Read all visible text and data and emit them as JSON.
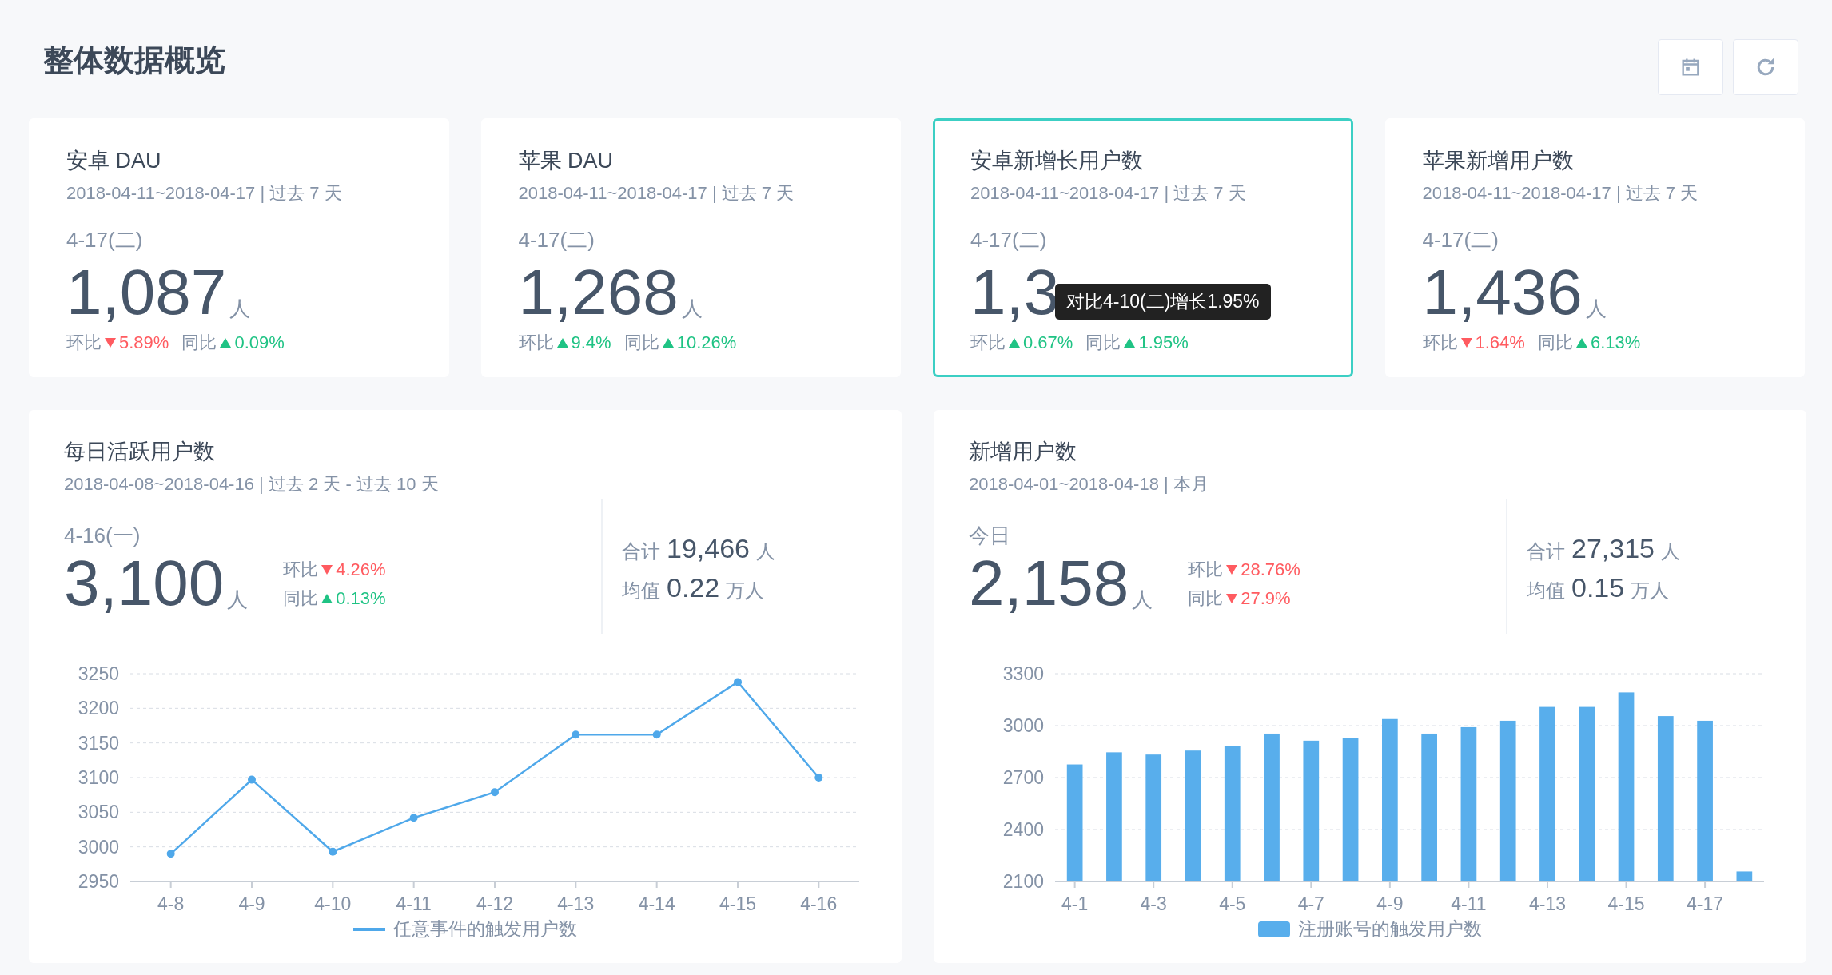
{
  "page": {
    "title": "整体数据概览"
  },
  "toolbar": [
    {
      "kind": "calendar"
    },
    {
      "kind": "refresh"
    }
  ],
  "summary_cards": [
    {
      "title": "安卓 DAU",
      "range": "2018-04-11~2018-04-17 | 过去 7 天",
      "date": "4-17(二)",
      "value": "1,087",
      "unit": "人",
      "selected": false,
      "compare": [
        {
          "label": "环比",
          "up": false,
          "change": "5.89%"
        },
        {
          "label": "同比",
          "up": true,
          "change": "0.09%"
        }
      ]
    },
    {
      "title": "苹果 DAU",
      "range": "2018-04-11~2018-04-17 | 过去 7 天",
      "date": "4-17(二)",
      "value": "1,268",
      "unit": "人",
      "selected": false,
      "compare": [
        {
          "label": "环比",
          "up": true,
          "change": "9.4%"
        },
        {
          "label": "同比",
          "up": true,
          "change": "10.26%"
        }
      ]
    },
    {
      "title": "安卓新增长用户数",
      "range": "2018-04-11~2018-04-17 | 过去 7 天",
      "date": "4-17(二)",
      "value": "1,3",
      "selected": true,
      "tooltip": "对比4-10(二)增长1.95%",
      "compare": [
        {
          "label": "环比",
          "up": true,
          "change": "0.67%"
        },
        {
          "label": "同比",
          "up": true,
          "change": "1.95%"
        }
      ]
    },
    {
      "title": "苹果新增用户数",
      "range": "2018-04-11~2018-04-17 | 过去 7 天",
      "date": "4-17(二)",
      "value": "1,436",
      "unit": "人",
      "selected": false,
      "compare": [
        {
          "label": "环比",
          "up": false,
          "change": "1.64%"
        },
        {
          "label": "同比",
          "up": true,
          "change": "6.13%"
        }
      ]
    }
  ],
  "chart_cards": [
    {
      "title": "每日活跃用户数",
      "range": "2018-04-08~2018-04-16 | 过去 2 天 - 过去 10 天",
      "date": "4-16(一)",
      "value": "3,100",
      "unit": "人",
      "compare": [
        {
          "label": "环比",
          "up": false,
          "change": "4.26%"
        },
        {
          "label": "同比",
          "up": true,
          "change": "0.13%"
        }
      ],
      "stats": [
        {
          "label": "合计",
          "value": "19,466",
          "unit": "人"
        },
        {
          "label": "均值",
          "value": "0.22",
          "unit": "万人"
        }
      ],
      "chart_data": {
        "type": "line",
        "categories": [
          "4-8",
          "4-9",
          "4-10",
          "4-11",
          "4-12",
          "4-13",
          "4-14",
          "4-15",
          "4-16"
        ],
        "series": [
          {
            "name": "任意事件的触发用户数",
            "color": "#4fa8ea",
            "marker": true,
            "values": [
              2990,
              3097,
              2993,
              3042,
              3079,
              3162,
              3162,
              3238,
              3100
            ]
          }
        ],
        "grid": true,
        "ylim": [
          2950,
          3250
        ],
        "yticks": [
          2950,
          3000,
          3050,
          3100,
          3150,
          3200,
          3250
        ]
      }
    },
    {
      "title": "新增用户数",
      "range": "2018-04-01~2018-04-18 | 本月",
      "date": "今日",
      "value": "2,158",
      "unit": "人",
      "compare": [
        {
          "label": "环比",
          "up": false,
          "change": "28.76%"
        },
        {
          "label": "同比",
          "up": false,
          "change": "27.9%"
        }
      ],
      "stats": [
        {
          "label": "合计",
          "value": "27,315",
          "unit": "人"
        },
        {
          "label": "均值",
          "value": "0.15",
          "unit": "万人"
        }
      ],
      "chart_data": {
        "type": "bar",
        "categories": [
          "4-1",
          null,
          "4-3",
          null,
          "4-5",
          null,
          "4-7",
          null,
          "4-9",
          null,
          "4-11",
          null,
          "4-13",
          null,
          "4-15",
          null,
          "4-17",
          null
        ],
        "grid": true,
        "series": [
          {
            "name": "注册账号的触发用户数",
            "color": "#58aeec",
            "values": [
              2776,
              2846,
              2833,
              2856,
              2880,
              2954,
              2913,
              2930,
              3038,
              2954,
              2991,
              3028,
              3108,
              3108,
              3192,
              3055,
              3028,
              2158
            ]
          }
        ],
        "ylim": [
          2100,
          3300
        ],
        "yticks": [
          2100,
          2400,
          2700,
          3000,
          3300
        ]
      }
    }
  ]
}
